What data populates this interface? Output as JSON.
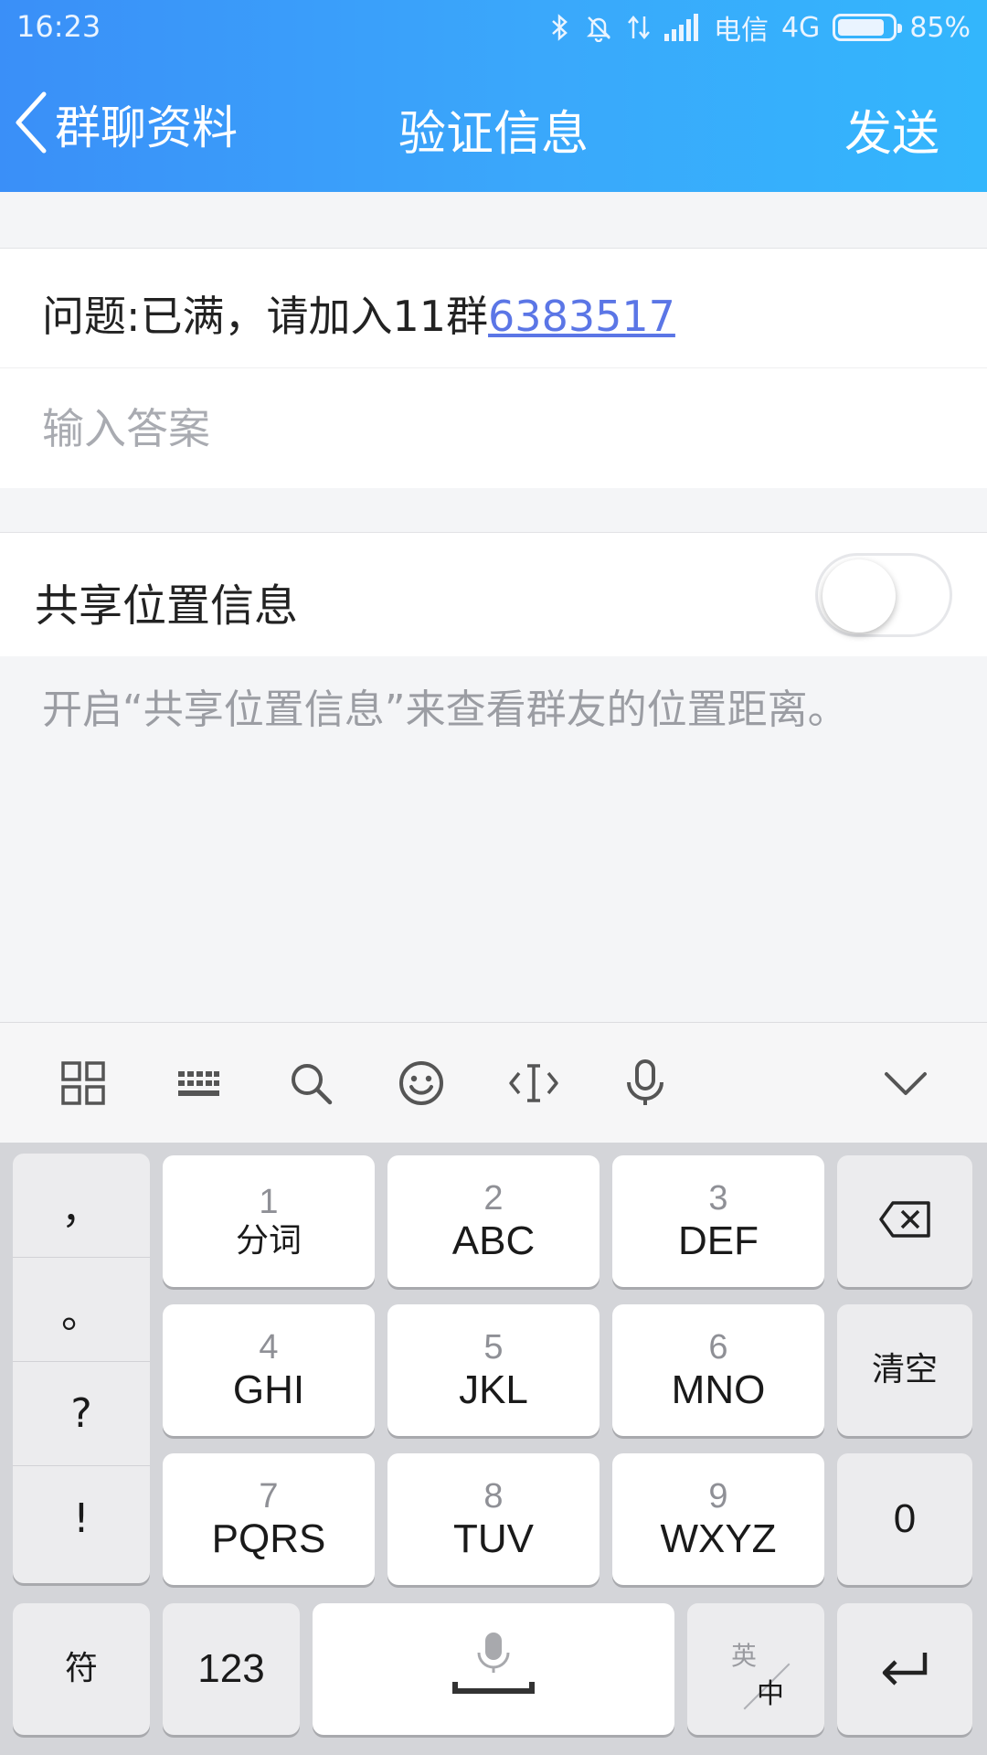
{
  "status_bar": {
    "time": "16:23",
    "carrier": "电信",
    "network": "4G",
    "battery_percent": "85%",
    "battery_level": 0.85
  },
  "nav": {
    "back_label": "群聊资料",
    "title": "验证信息",
    "send_label": "发送"
  },
  "question": {
    "prefix": "问题:已满，请加入11群",
    "link": "6383517"
  },
  "answer": {
    "placeholder": "输入答案",
    "value": ""
  },
  "share_location": {
    "label": "共享位置信息",
    "enabled": false
  },
  "hint": "开启“共享位置信息”来查看群友的位置距离。",
  "keyboard": {
    "toolbar_icons": [
      "grid-icon",
      "keyboard-icon",
      "search-icon",
      "emoji-icon",
      "cursor-icon",
      "microphone-icon",
      "chevron-down-icon"
    ],
    "punctuation": [
      "，",
      "。",
      "?",
      "!"
    ],
    "keys": [
      {
        "num": "1",
        "label": "分词"
      },
      {
        "num": "2",
        "label": "ABC"
      },
      {
        "num": "3",
        "label": "DEF"
      },
      {
        "num": "4",
        "label": "GHI"
      },
      {
        "num": "5",
        "label": "JKL"
      },
      {
        "num": "6",
        "label": "MNO"
      },
      {
        "num": "7",
        "label": "PQRS"
      },
      {
        "num": "8",
        "label": "TUV"
      },
      {
        "num": "9",
        "label": "WXYZ"
      }
    ],
    "clear_label": "清空",
    "zero_label": "0",
    "symbol_label": "符",
    "num_label": "123",
    "lang_top": "英",
    "lang_bottom": "中"
  },
  "colors": {
    "header_start": "#3a8ff8",
    "header_end": "#33b6fc",
    "link": "#5b76e6",
    "hint": "#9b9da3",
    "keyboard_bg": "#d4d5d9"
  }
}
